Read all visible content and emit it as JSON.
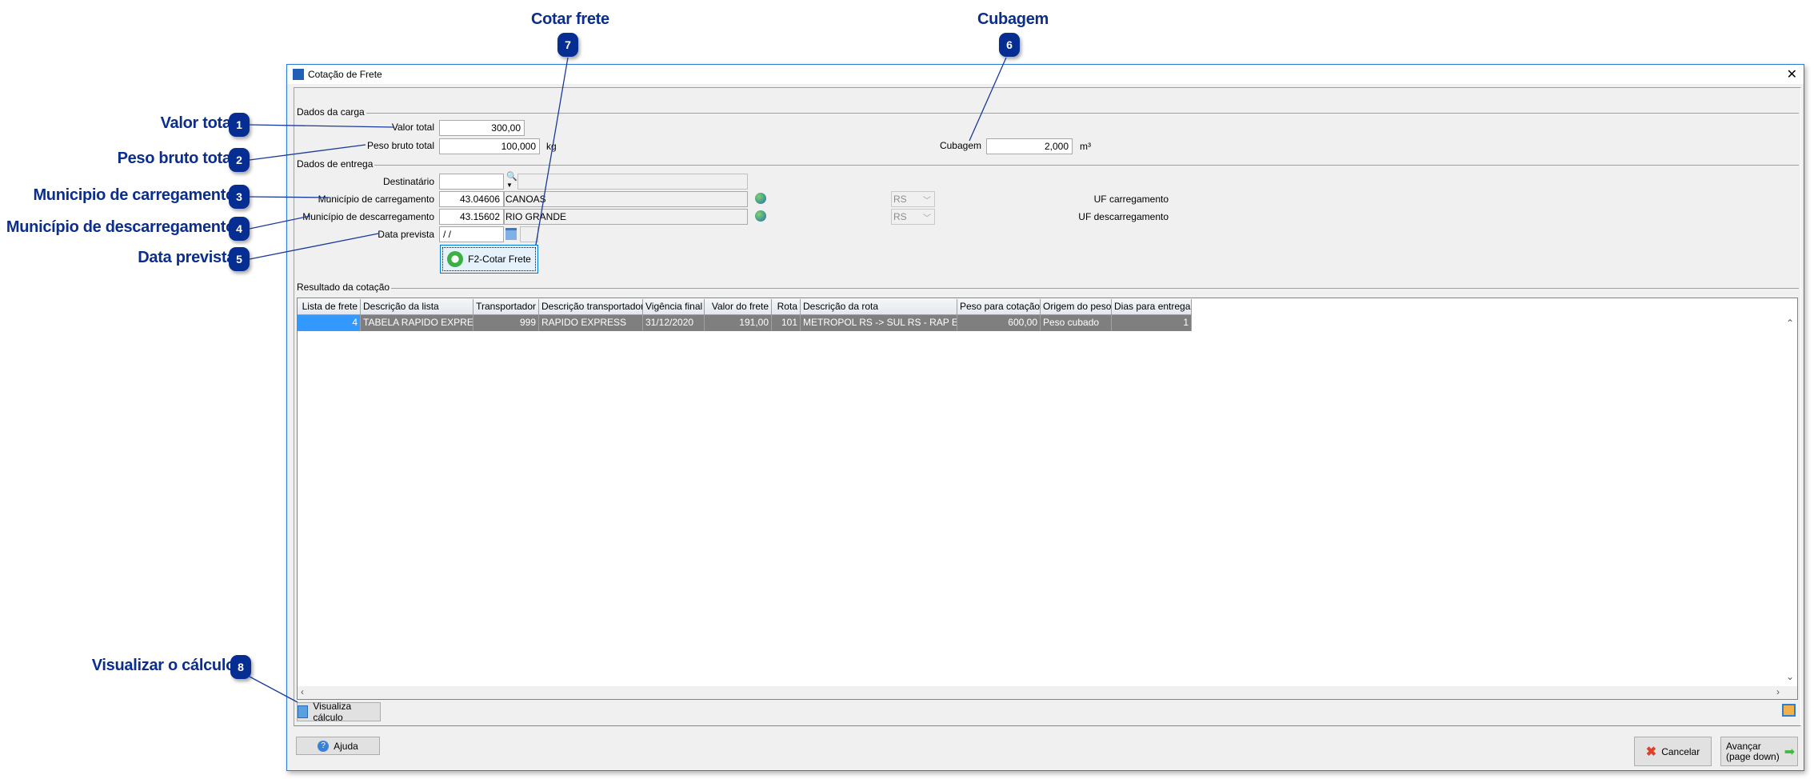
{
  "callouts": [
    {
      "num": "1",
      "label": "Valor total"
    },
    {
      "num": "2",
      "label": "Peso bruto total"
    },
    {
      "num": "3",
      "label": "Municipio de carregamento"
    },
    {
      "num": "4",
      "label": "Município de descarregamento"
    },
    {
      "num": "5",
      "label": "Data prevista"
    },
    {
      "num": "6",
      "label": "Cubagem"
    },
    {
      "num": "7",
      "label": "Cotar frete"
    },
    {
      "num": "8",
      "label": "Visualizar o cálculo"
    }
  ],
  "window": {
    "title": "Cotação de Frete",
    "close": "✕"
  },
  "carga": {
    "section": "Dados da carga",
    "valor_total_label": "Valor total",
    "valor_total": "300,00",
    "peso_label": "Peso bruto total",
    "peso": "100,000",
    "peso_unit": "kg",
    "cubagem_label": "Cubagem",
    "cubagem": "2,000",
    "cubagem_unit": "m³"
  },
  "entrega": {
    "section": "Dados de entrega",
    "destinatario_label": "Destinatário",
    "destinatario_code": "",
    "destinatario_name": "",
    "mun_carreg_label": "Município de carregamento",
    "mun_carreg_code": "43.04606",
    "mun_carreg_name": "CANOAS",
    "mun_descarreg_label": "Município de descarregamento",
    "mun_descarreg_code": "43.15602",
    "mun_descarreg_name": "RIO GRANDE",
    "uf_carreg_label": "UF carregamento",
    "uf_carreg": "RS",
    "uf_descarreg_label": "UF descarregamento",
    "uf_descarreg": "RS",
    "data_label": "Data prevista",
    "data": " /  /",
    "cotar_button": "F2-Cotar Frete"
  },
  "resultado": {
    "section": "Resultado da cotação",
    "columns": [
      "Lista de frete",
      "Descrição da lista",
      "Transportador",
      "Descrição transportador",
      "Vigência final",
      "Valor do frete",
      "Rota",
      "Descrição da rota",
      "Peso para cotação",
      "Origem do peso",
      "Dias para entrega"
    ],
    "rows": [
      [
        "4",
        "TABELA RAPIDO EXPRESS",
        "999",
        "RAPIDO EXPRESS",
        "31/12/2020",
        "191,00",
        "101",
        "METROPOL RS -> SUL RS - RAP EXPR",
        "600,00",
        "Peso cubado",
        "1"
      ]
    ]
  },
  "buttons": {
    "visualiza": "Visualiza cálculo",
    "ajuda": "Ajuda",
    "cancelar": "Cancelar",
    "avancar": "Avançar",
    "avancar_sub": "(page down)"
  },
  "colors": {
    "accent": "#062d91",
    "selection": "#3399ff",
    "row": "#7f7f7f"
  }
}
